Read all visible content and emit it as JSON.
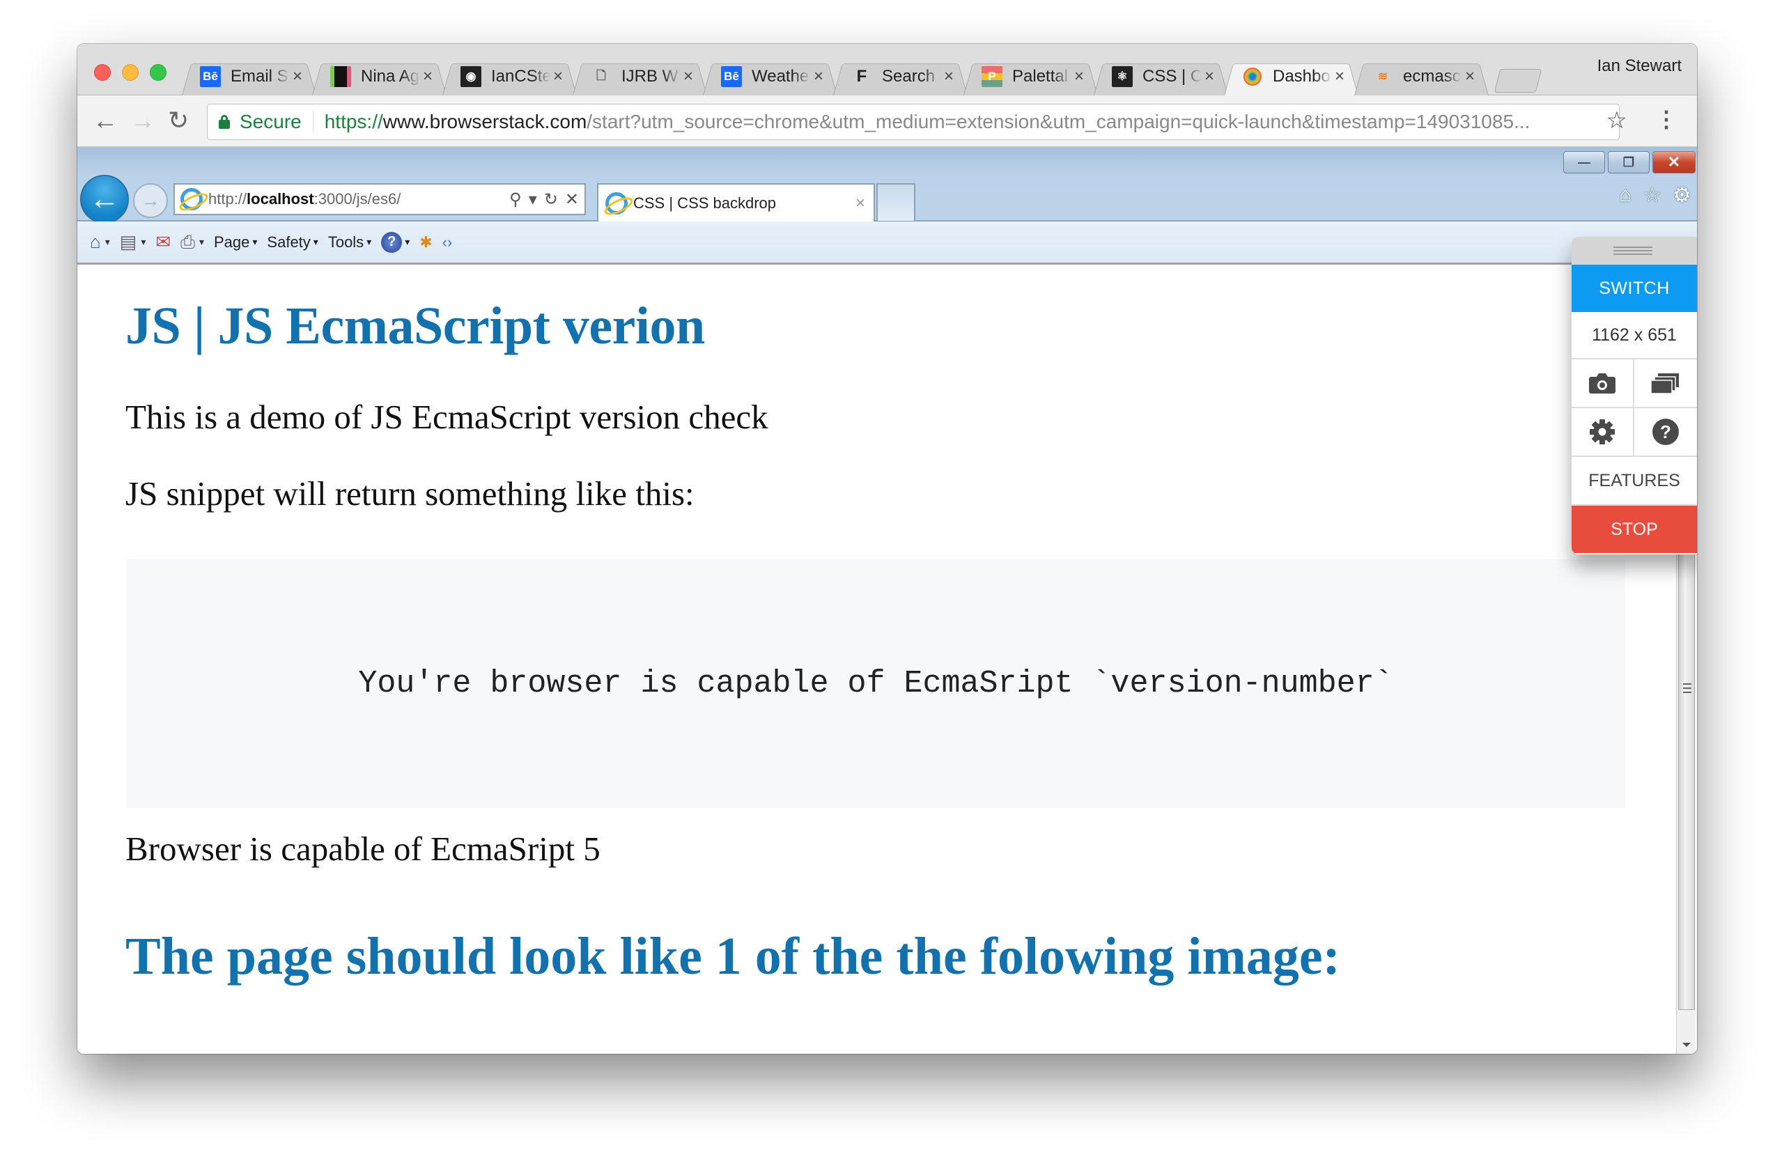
{
  "chrome": {
    "tabs": [
      {
        "title": "Email S",
        "icon": "behance-icon",
        "icon_text": "Bē",
        "icon_color": "#1769ff",
        "active": false
      },
      {
        "title": "Nina Ag",
        "icon": "nina-favicon-icon",
        "icon_text": "",
        "icon_color": "#222222",
        "active": false
      },
      {
        "title": "IanCSte",
        "icon": "github-icon",
        "icon_text": "◉",
        "icon_color": "#222222",
        "active": false
      },
      {
        "title": "IJRB W",
        "icon": "document-icon",
        "icon_text": "🗋",
        "icon_color": "#ffffff",
        "active": false
      },
      {
        "title": "Weathe",
        "icon": "behance-icon",
        "icon_text": "Bē",
        "icon_color": "#1769ff",
        "active": false
      },
      {
        "title": "Search",
        "icon": "f-logo-icon",
        "icon_text": "F",
        "icon_color": "#222222",
        "active": false
      },
      {
        "title": "Palettal",
        "icon": "palettab-icon",
        "icon_text": "P",
        "icon_color": "#e8b40a",
        "active": false
      },
      {
        "title": "CSS | C",
        "icon": "react-icon",
        "icon_text": "⚛",
        "icon_color": "#222222",
        "active": false
      },
      {
        "title": "Dashbo",
        "icon": "browserstack-icon",
        "icon_text": "◎",
        "icon_color": "#f0f0f0",
        "active": true
      },
      {
        "title": "ecmasc",
        "icon": "stackoverflow-icon",
        "icon_text": "≋",
        "icon_color": "#f0f0f0",
        "active": false
      }
    ],
    "tab_close": "×",
    "profile_name": "Ian Stewart",
    "nav": {
      "back": "←",
      "forward": "→",
      "reload": "↻"
    },
    "omnibox": {
      "secure_label": "Secure",
      "url_scheme": "https://",
      "url_host": "www.browserstack.com",
      "url_rest": "/start?utm_source=chrome&utm_medium=extension&utm_campaign=quick-launch&timestamp=149031085..."
    },
    "star": "☆",
    "menu": "⋮"
  },
  "ie": {
    "window_buttons": {
      "minimize": "—",
      "restore": "❐",
      "close": "✕"
    },
    "back": "←",
    "forward": "→",
    "address": {
      "prefix": "http://",
      "host": "localhost",
      "rest": ":3000/js/es6/"
    },
    "address_icons": {
      "search": "⚲",
      "dropdown": "▾",
      "refresh": "↻",
      "stop": "✕"
    },
    "tab_title": "CSS | CSS backdrop",
    "tab_close": "×",
    "right_icons": {
      "home": "⌂",
      "favorites": "☆",
      "tools": "⚙"
    },
    "command_bar": {
      "home": "⌂",
      "feeds": "▤",
      "mail": "✉",
      "print": "⎙",
      "page": "Page",
      "safety": "Safety",
      "tools": "Tools",
      "help": "?",
      "caret": "▾"
    }
  },
  "page": {
    "title": "JS | JS EcmaScript verion",
    "intro": "This is a demo of JS EcmaScript version check",
    "snippet_lead": "JS snippet will return something like this:",
    "code": "You're browser is capable of EcmaSript `version-number`",
    "result": "Browser is capable of EcmaSript 5",
    "subtitle": "The page should look like 1 of the the folowing image:"
  },
  "browserstack": {
    "switch": "SWITCH",
    "resolution": "1162 x 651",
    "features": "FEATURES",
    "stop": "STOP",
    "colors": {
      "switch": "#0d9af2",
      "stop": "#e84c3d"
    }
  }
}
